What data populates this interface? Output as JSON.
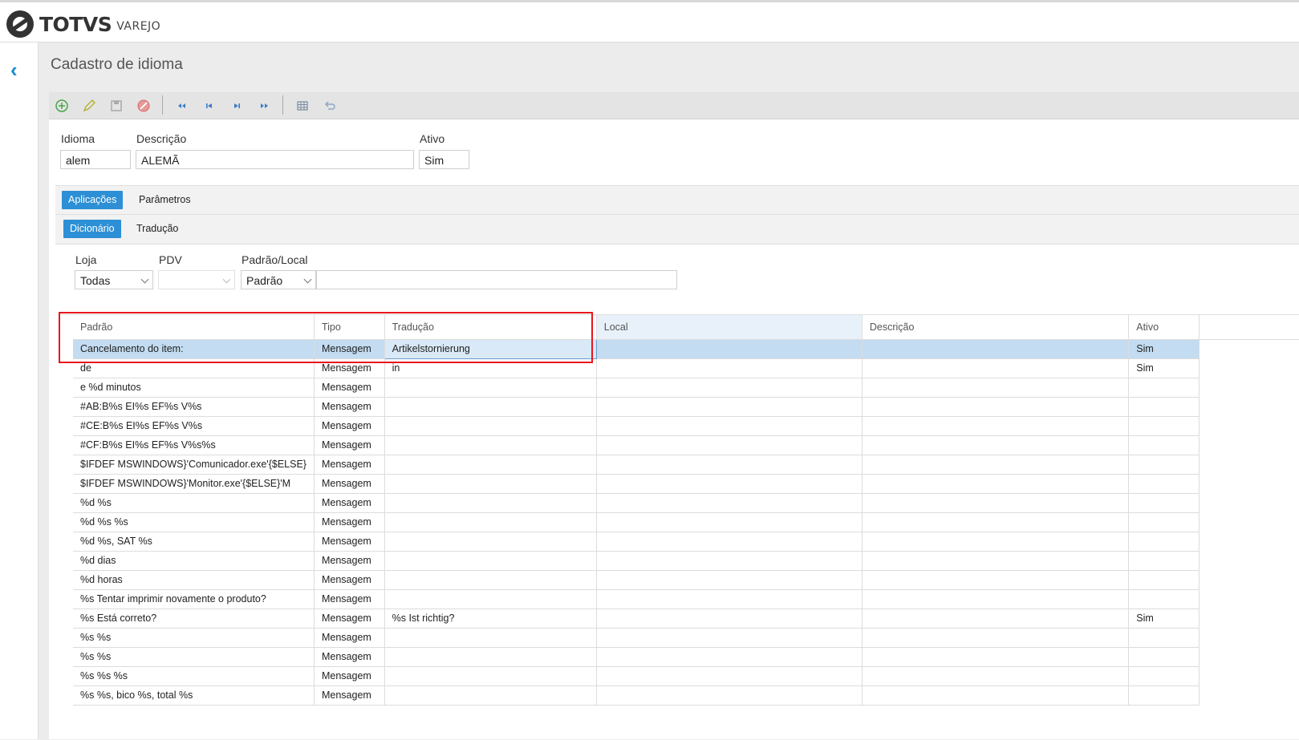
{
  "brand": {
    "name": "TOTVS",
    "product": "VAREJO"
  },
  "page": {
    "title": "Cadastro de idioma"
  },
  "colors": {
    "accent": "#2d8fd5",
    "highlight": "#e8151d",
    "selected_row": "#c3dcf1"
  },
  "toolbar": {
    "icons": [
      "add-icon",
      "edit-icon",
      "save-icon",
      "cancel-icon",
      "first-icon",
      "previous-icon",
      "next-icon",
      "last-icon",
      "grid-icon",
      "undo-icon"
    ]
  },
  "form": {
    "idioma": {
      "label": "Idioma",
      "value": "alem"
    },
    "descricao": {
      "label": "Descrição",
      "value": "ALEMÃ"
    },
    "ativo": {
      "label": "Ativo",
      "value": "Sim"
    }
  },
  "tabs": {
    "aplicacoes": "Aplicações",
    "parametros": "Parâmetros"
  },
  "subtabs": {
    "dicionario": "Dicionário",
    "traducao": "Tradução"
  },
  "filters": {
    "loja": {
      "label": "Loja",
      "value": "Todas"
    },
    "pdv": {
      "label": "PDV",
      "value": ""
    },
    "padrao_local": {
      "label": "Padrão/Local",
      "value": "Padrão",
      "text": ""
    }
  },
  "grid": {
    "columns": [
      "Padrão",
      "Tipo",
      "Tradução",
      "Local",
      "Descrição",
      "Ativo"
    ],
    "rows": [
      [
        "Cancelamento do item:",
        "Mensagem",
        "Artikelstornierung",
        "",
        "",
        "Sim"
      ],
      [
        "de",
        "Mensagem",
        "in",
        "",
        "",
        "Sim"
      ],
      [
        "e %d minutos",
        "Mensagem",
        "",
        "",
        "",
        ""
      ],
      [
        "#AB:B%s EI%s EF%s V%s",
        "Mensagem",
        "",
        "",
        "",
        ""
      ],
      [
        "#CE:B%s EI%s EF%s V%s",
        "Mensagem",
        "",
        "",
        "",
        ""
      ],
      [
        "#CF:B%s EI%s EF%s V%s%s",
        "Mensagem",
        "",
        "",
        "",
        ""
      ],
      [
        "$IFDEF MSWINDOWS}'Comunicador.exe'{$ELSE}",
        "Mensagem",
        "",
        "",
        "",
        ""
      ],
      [
        "$IFDEF MSWINDOWS}'Monitor.exe'{$ELSE}'M",
        "Mensagem",
        "",
        "",
        "",
        ""
      ],
      [
        "%d %s",
        "Mensagem",
        "",
        "",
        "",
        ""
      ],
      [
        "%d %s %s",
        "Mensagem",
        "",
        "",
        "",
        ""
      ],
      [
        "%d %s, SAT %s",
        "Mensagem",
        "",
        "",
        "",
        ""
      ],
      [
        "%d dias",
        "Mensagem",
        "",
        "",
        "",
        ""
      ],
      [
        "%d horas",
        "Mensagem",
        "",
        "",
        "",
        ""
      ],
      [
        "%s Tentar imprimir novamente o produto?",
        "Mensagem",
        "",
        "",
        "",
        ""
      ],
      [
        "%s Está correto?",
        "Mensagem",
        "%s Ist richtig?",
        "",
        "",
        "Sim"
      ],
      [
        "%s %s",
        "Mensagem",
        "",
        "",
        "",
        ""
      ],
      [
        "%s %s",
        "Mensagem",
        "",
        "",
        "",
        ""
      ],
      [
        "%s %s %s",
        "Mensagem",
        "",
        "",
        "",
        ""
      ],
      [
        "%s %s, bico %s, total %s",
        "Mensagem",
        "",
        "",
        "",
        ""
      ]
    ]
  }
}
